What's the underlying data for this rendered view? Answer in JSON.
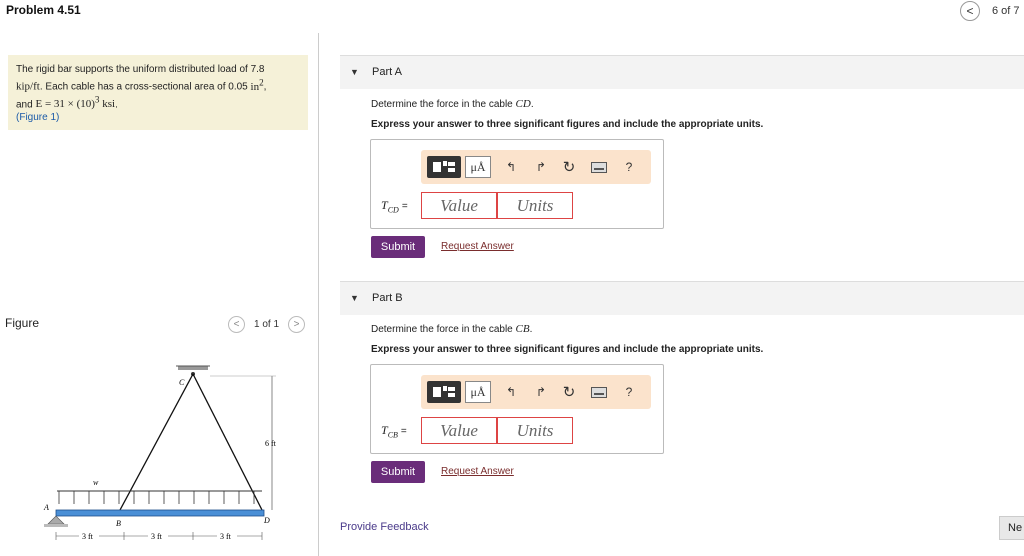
{
  "header": {
    "title": "Problem 4.51",
    "pager_prev": "<",
    "pager_text": "6 of 7"
  },
  "problem": {
    "line1_pre": "The rigid bar supports the uniform distributed load of 7.8",
    "unit_kipft": "kip/ft",
    "line2_mid": ". Each cable has a cross-sectional area of 0.05",
    "area_unit": "in",
    "area_exp": "2",
    "comma": ",",
    "line3_pre": "and",
    "E_expr": "E = 31 × (10)",
    "E_exp": "3",
    "E_unit": "ksi",
    "period": ".",
    "figure_link": "(Figure 1)"
  },
  "figure_panel": {
    "label": "Figure",
    "prev": "<",
    "count": "1 of 1",
    "next": ">",
    "labels": {
      "C": "C",
      "A": "A",
      "B": "B",
      "D": "D",
      "w": "w",
      "height": "6 ft",
      "span1": "3 ft",
      "span2": "3 ft",
      "span3": "3 ft"
    }
  },
  "parts": [
    {
      "triangle": "▼",
      "title": "Part A",
      "question_pre": "Determine the force in the cable",
      "question_var": "CD",
      "question_post": ".",
      "instruction": "Express your answer to three significant figures and include the appropriate units.",
      "var_main": "T",
      "var_sub": "CD",
      "var_eq": "=",
      "value_placeholder": "Value",
      "units_placeholder": "Units",
      "submit": "Submit",
      "request": "Request Answer"
    },
    {
      "triangle": "▼",
      "title": "Part B",
      "question_pre": "Determine the force in the cable",
      "question_var": "CB",
      "question_post": ".",
      "instruction": "Express your answer to three significant figures and include the appropriate units.",
      "var_main": "T",
      "var_sub": "CB",
      "var_eq": "=",
      "value_placeholder": "Value",
      "units_placeholder": "Units",
      "submit": "Submit",
      "request": "Request Answer"
    }
  ],
  "toolbar": {
    "mu_label": "μÅ",
    "undo_icon": "↰",
    "redo_icon": "↱",
    "reset_icon": "↻",
    "help": "?"
  },
  "footer": {
    "feedback": "Provide Feedback",
    "next": "Ne"
  },
  "colors": {
    "problem_bg": "#f5f1d8",
    "submit_bg": "#6a2d7a",
    "toolbar_bg": "#fbe3cc",
    "field_border": "#d44"
  }
}
